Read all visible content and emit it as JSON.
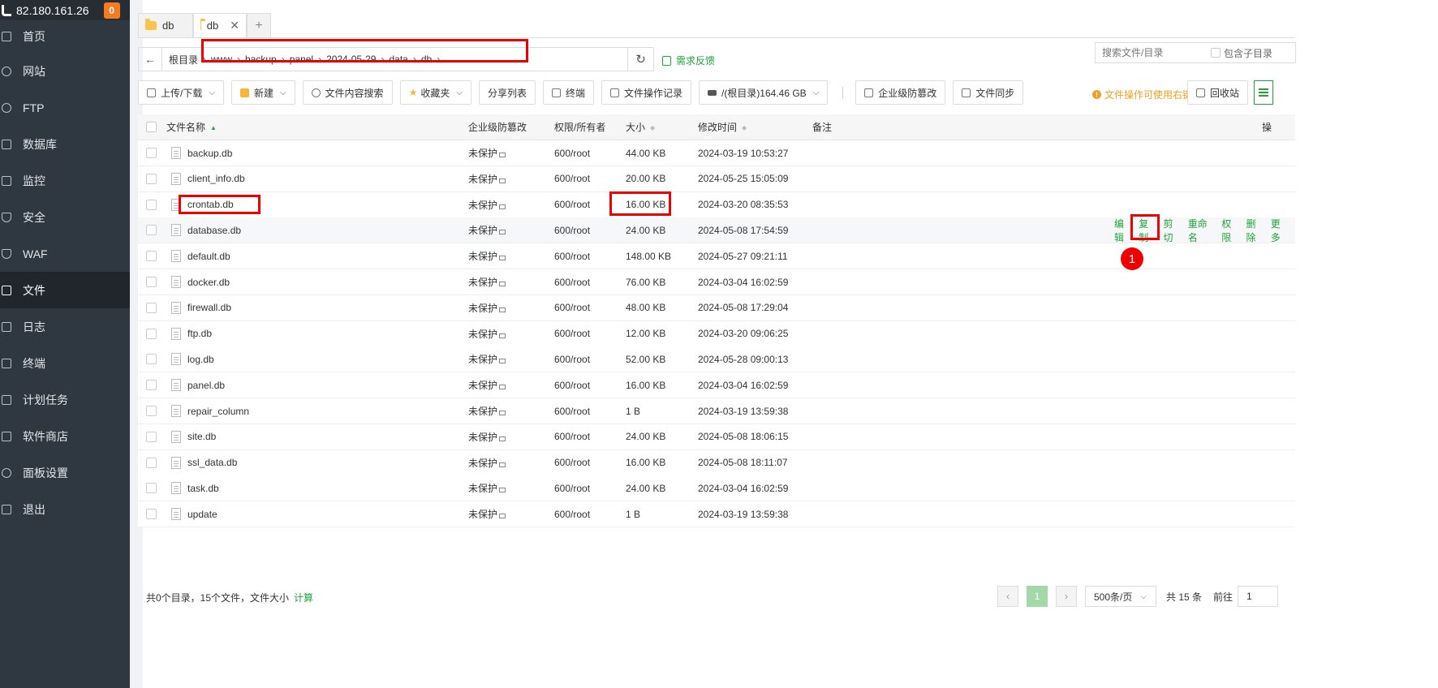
{
  "sidebar": {
    "server_ip": "82.180.161.26",
    "badge_count": "0",
    "items": [
      {
        "label": "首页",
        "icon": "home-icon"
      },
      {
        "label": "网站",
        "icon": "globe-icon"
      },
      {
        "label": "FTP",
        "icon": "ftp-icon"
      },
      {
        "label": "数据库",
        "icon": "database-icon"
      },
      {
        "label": "监控",
        "icon": "monitor-icon"
      },
      {
        "label": "安全",
        "icon": "shield-icon"
      },
      {
        "label": "WAF",
        "icon": "waf-icon"
      },
      {
        "label": "文件",
        "icon": "folder-icon"
      },
      {
        "label": "日志",
        "icon": "log-icon"
      },
      {
        "label": "终端",
        "icon": "terminal-icon"
      },
      {
        "label": "计划任务",
        "icon": "calendar-icon"
      },
      {
        "label": "软件商店",
        "icon": "grid-icon"
      },
      {
        "label": "面板设置",
        "icon": "gear-icon"
      },
      {
        "label": "退出",
        "icon": "logout-icon"
      }
    ],
    "active_index": 7
  },
  "tabs": [
    {
      "label": "db",
      "active": false
    },
    {
      "label": "db",
      "active": true
    }
  ],
  "path": {
    "root": "根目录",
    "segments": [
      "www",
      "backup",
      "panel",
      "2024-05-29",
      "data",
      "db"
    ]
  },
  "feedback_label": "需求反馈",
  "search": {
    "placeholder": "搜索文件/目录",
    "include_sub_label": "包含子目录"
  },
  "toolbar": {
    "upload": "上传/下载",
    "new": "新建",
    "content_search": "文件内容搜索",
    "favorites": "收藏夹",
    "share_list": "分享列表",
    "terminal": "终端",
    "op_log": "文件操作记录",
    "disk": "/(根目录)164.46 GB",
    "tamper": "企业级防篡改",
    "sync": "文件同步",
    "tip": "文件操作可使用右键",
    "recycle": "回收站"
  },
  "table": {
    "headers": {
      "name": "文件名称",
      "enterprise": "企业级防篡改",
      "perm": "权限/所有者",
      "size": "大小",
      "mtime": "修改时间",
      "note": "备注",
      "ops": "操"
    },
    "rows": [
      {
        "name": "backup.db",
        "ent": "未保护",
        "perm": "600/root",
        "size": "44.00 KB",
        "mtime": "2024-03-19 10:53:27"
      },
      {
        "name": "client_info.db",
        "ent": "未保护",
        "perm": "600/root",
        "size": "20.00 KB",
        "mtime": "2024-05-25 15:05:09"
      },
      {
        "name": "crontab.db",
        "ent": "未保护",
        "perm": "600/root",
        "size": "16.00 KB",
        "mtime": "2024-03-20 08:35:53"
      },
      {
        "name": "database.db",
        "ent": "未保护",
        "perm": "600/root",
        "size": "24.00 KB",
        "mtime": "2024-05-08 17:54:59"
      },
      {
        "name": "default.db",
        "ent": "未保护",
        "perm": "600/root",
        "size": "148.00 KB",
        "mtime": "2024-05-27 09:21:11"
      },
      {
        "name": "docker.db",
        "ent": "未保护",
        "perm": "600/root",
        "size": "76.00 KB",
        "mtime": "2024-03-04 16:02:59"
      },
      {
        "name": "firewall.db",
        "ent": "未保护",
        "perm": "600/root",
        "size": "48.00 KB",
        "mtime": "2024-05-08 17:29:04"
      },
      {
        "name": "ftp.db",
        "ent": "未保护",
        "perm": "600/root",
        "size": "12.00 KB",
        "mtime": "2024-03-20 09:06:25"
      },
      {
        "name": "log.db",
        "ent": "未保护",
        "perm": "600/root",
        "size": "52.00 KB",
        "mtime": "2024-05-28 09:00:13"
      },
      {
        "name": "panel.db",
        "ent": "未保护",
        "perm": "600/root",
        "size": "16.00 KB",
        "mtime": "2024-03-04 16:02:59"
      },
      {
        "name": "repair_column",
        "ent": "未保护",
        "perm": "600/root",
        "size": "1 B",
        "mtime": "2024-03-19 13:59:38"
      },
      {
        "name": "site.db",
        "ent": "未保护",
        "perm": "600/root",
        "size": "24.00 KB",
        "mtime": "2024-05-08 18:06:15"
      },
      {
        "name": "ssl_data.db",
        "ent": "未保护",
        "perm": "600/root",
        "size": "16.00 KB",
        "mtime": "2024-05-08 18:11:07"
      },
      {
        "name": "task.db",
        "ent": "未保护",
        "perm": "600/root",
        "size": "24.00 KB",
        "mtime": "2024-03-04 16:02:59"
      },
      {
        "name": "update",
        "ent": "未保护",
        "perm": "600/root",
        "size": "1 B",
        "mtime": "2024-03-19 13:59:38"
      }
    ],
    "hover_row_ops": [
      "编辑",
      "复制",
      "剪切",
      "重命名",
      "权限",
      "删除",
      "更多"
    ]
  },
  "annotation_marker": "1",
  "footer": {
    "summary": "共0个目录，15个文件，文件大小",
    "calc": "计算",
    "prev": "‹",
    "page": "1",
    "next": "›",
    "per_page": "500条/页",
    "total": "共 15 条",
    "goto": "前往",
    "goto_value": "1"
  }
}
